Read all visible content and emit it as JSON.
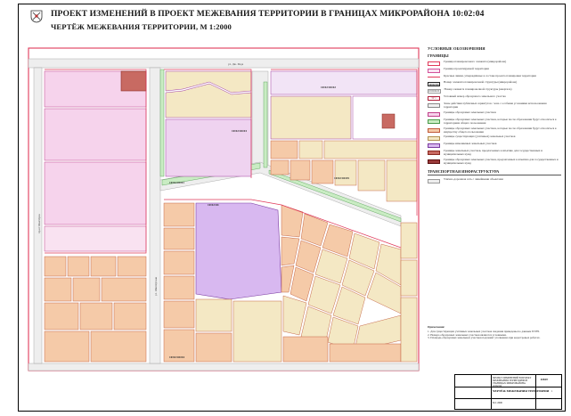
{
  "header": {
    "title": "ПРОЕКТ ИЗМЕНЕНИЙ В ПРОЕКТ МЕЖЕВАНИЯ ТЕРРИТОРИИ В ГРАНИЦАХ МИКРОРАЙОНА 10:02:04",
    "subtitle": "ЧЕРТЁЖ МЕЖЕВАНИЯ ТЕРРИТОРИИ, М 1:2000"
  },
  "map": {
    "block_labels": [
      "10:02:04",
      "10:02:04:02",
      "10:02:04:03",
      "10:02:04:05",
      "10:02:04:01",
      "10:02:04:04"
    ],
    "street_labels": [
      "ул. Дж. Рида",
      "пр-кт Шахтёров",
      "ул. Шахтёрская"
    ]
  },
  "legend": {
    "heading": "УСЛОВНЫЕ ОБОЗНАЧЕНИЯ",
    "subheading": "ГРАНИЦЫ",
    "items": [
      {
        "text": "Граница планировочного элемента (микрорайона)",
        "style": "red-box"
      },
      {
        "text": "Граница проектируемой территории",
        "style": "pink-box"
      },
      {
        "text": "Красные линии, утверждённые в составе проекта планировки территории",
        "style": "red-line"
      },
      {
        "text": "Номер элемента планировочной структуры (микрорайона)",
        "style": "label-code",
        "code": "10:02:04"
      },
      {
        "text": "Номер элемента планировочной структуры (квартала)",
        "style": "label-code",
        "code": "10:02:04:01"
      },
      {
        "text": "Условный номер образуемого земельного участка",
        "style": "num-box",
        "code": "ЗУ 1"
      },
      {
        "text": "Зоны действия публичных сервитутов / зона с особыми условиями использования территории",
        "style": "grey-box"
      },
      {
        "text": "Границы образуемых земельных участков",
        "style": "pink-fill"
      },
      {
        "text": "Границы образуемых земельных участков, которые после образования будут относиться к территориям общего пользования",
        "style": "green-fill"
      },
      {
        "text": "Границы образуемых земельных участков, которые после образования будут относиться к имуществу общего пользования",
        "style": "peach-fill"
      },
      {
        "text": "Границы существующих (учтённых) земельных участков",
        "style": "beige-fill"
      },
      {
        "text": "Границы изменяемых земельных участков",
        "style": "violet-fill"
      },
      {
        "text": "Границы земельных участков, предлагаемых к изъятию для государственных и муниципальных нужд",
        "style": "brown-fill"
      },
      {
        "text": "Границы образуемых земельных участков, предлагаемых к изъятию для государственных и муниципальных нужд",
        "style": "darkred-fill"
      }
    ],
    "transport_heading": "ТРАНСПОРТНАЯ ИНФРАСТРУКТУРА",
    "transport_items": [
      {
        "text": "Улично-дорожная сеть с линейными объектами",
        "style": "road"
      }
    ]
  },
  "notes": {
    "heading": "Примечания:",
    "lines": [
      "1. Для существующих учтённых земельных участков сведения приведены по данным ЕГРН.",
      "2. Номера образуемых земельных участков являются условными.",
      "3. Площадь образуемых земельных участков подлежит уточнению при кадастровых работах."
    ]
  },
  "stamp": {
    "org_title": "ПРОЕКТ ИЗМЕНЕНИЙ В ПРОЕКТ МЕЖЕВАНИЯ ТЕРРИТОРИИ В ГРАНИЦАХ МИКРОРАЙОНА 10:02:04",
    "sheet_name": "ЧЕРТЁЖ МЕЖЕВАНИЯ ТЕРРИТОРИИ",
    "scale": "М 1:2000",
    "stage": "ПМТ",
    "sheet": "1",
    "sheets": "1"
  }
}
